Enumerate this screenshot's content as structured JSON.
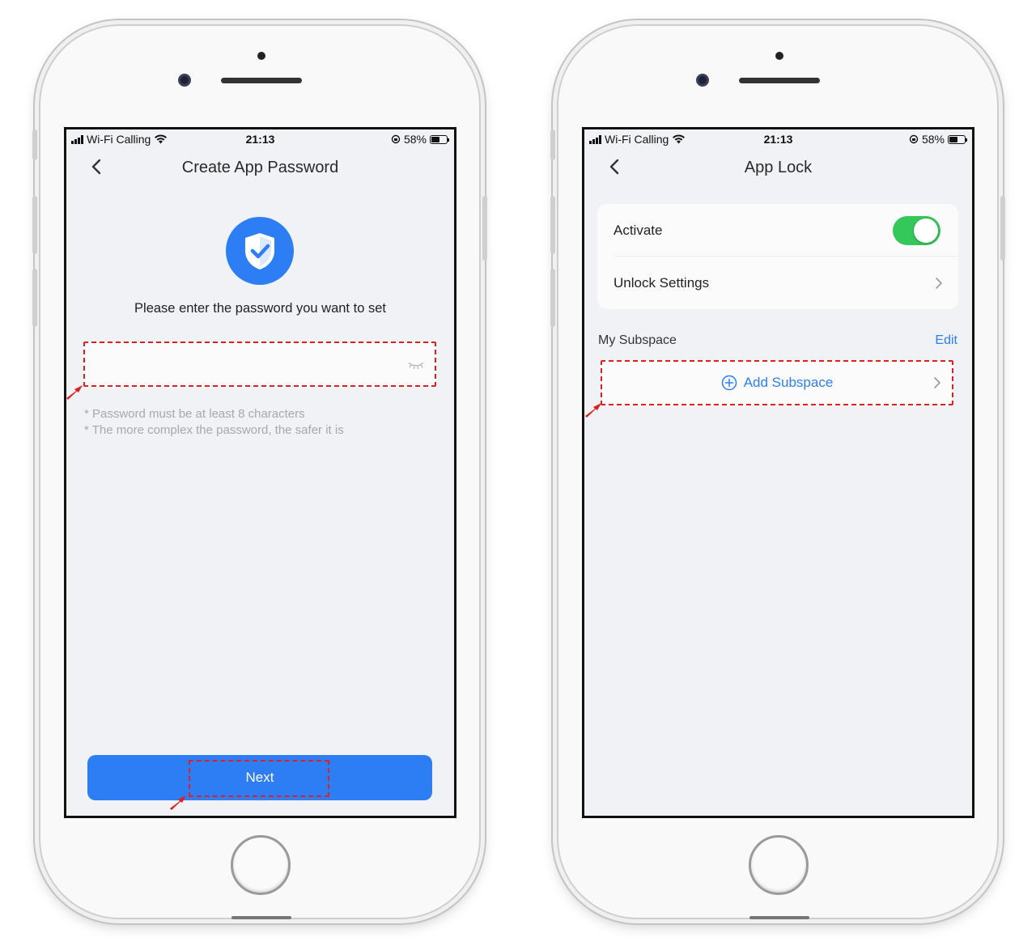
{
  "status_bar": {
    "carrier": "Wi-Fi Calling",
    "time": "21:13",
    "battery_percent": "58%"
  },
  "left_screen": {
    "title": "Create App Password",
    "prompt": "Please enter the password you want to set",
    "password_value": "",
    "hints": [
      "* Password must be at least 8 characters",
      "* The more complex the password, the safer it is"
    ],
    "next_label": "Next"
  },
  "right_screen": {
    "title": "App Lock",
    "activate_label": "Activate",
    "activate_on": true,
    "unlock_settings_label": "Unlock Settings",
    "section_label": "My Subspace",
    "edit_label": "Edit",
    "add_subspace_label": "Add Subspace"
  },
  "colors": {
    "accent": "#2d7ef5",
    "toggle_on": "#34c75a",
    "highlight": "#e02020",
    "screen_bg": "#f1f2f6"
  },
  "icons": [
    "back-chevron-icon",
    "shield-check-icon",
    "eye-off-icon",
    "chevron-right-icon",
    "plus-circle-icon",
    "wifi-icon",
    "signal-icon",
    "battery-icon",
    "orientation-lock-icon"
  ]
}
